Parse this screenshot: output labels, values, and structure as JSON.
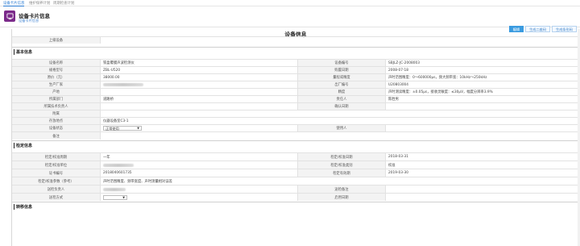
{
  "topnav": {
    "tabs": [
      "设备卡片信息",
      "维护保养计划",
      "周期检查计划"
    ]
  },
  "header": {
    "title": "设备卡片信息",
    "breadcrumb": "设备卡片信息"
  },
  "actions": {
    "edit": "编辑",
    "gen_qr": "生成二维码",
    "print_qr": "生成条形码"
  },
  "sheet": {
    "title": "设备信息"
  },
  "parent_device": {
    "label": "上级设备",
    "value": ""
  },
  "basic": {
    "section": "基本信息",
    "rows": [
      {
        "l1": "设备名称",
        "v1": "铁盒覆膜声波检测仪",
        "l2": "设备编号",
        "v2": "SBJLZ-JC-2008003"
      },
      {
        "l1": "规格型号",
        "v1": "ZBL-U520",
        "l2": "购置日期",
        "v2": "2008-07-18"
      },
      {
        "l1": "原价（元）",
        "v1": "38000.00",
        "l2": "量程或精度",
        "v2": "声时范围精度：0～600000μs，频大频带宽：10kHz～250kHz"
      },
      {
        "l1": "生产厂家",
        "v1": "",
        "l2": "出厂编号",
        "v2": "U20803004"
      },
      {
        "l1": "产地",
        "v1": "",
        "l2": "精度",
        "v2": "声时测读精度：±0.05μs，接收灵敏度：≤30μV，幅度分辨率3.9%"
      },
      {
        "l1": "所属部门",
        "v1": "道路桥",
        "l2": "责任人",
        "v2": "陈胜男"
      },
      {
        "l1": "所属技术负责人",
        "v1": "",
        "l2": "确认日期",
        "v2": ""
      },
      {
        "l1": "附属",
        "v1": "",
        "l2": "",
        "v2": ""
      },
      {
        "l1": "存放地点",
        "v1": "仪器设备室C3-1",
        "l2": "",
        "v2": ""
      },
      {
        "l1": "设备状态",
        "v1": "正常使用",
        "l2": "使用人",
        "v2": ""
      },
      {
        "l1": "备注",
        "v1": "",
        "l2": "",
        "v2": ""
      }
    ]
  },
  "verify": {
    "section": "检定信息",
    "rows": [
      {
        "l1": "检定/校准周期",
        "v1": "一年",
        "l2": "检定/校准日期",
        "v2": "2018-03-31"
      },
      {
        "l1": "检定/校准单位",
        "v1": "",
        "l2": "检定/校准类别",
        "v2": "校准"
      },
      {
        "l1": "证书编号",
        "v1": "2018040601735",
        "l2": "检定有效期",
        "v2": "2019-03-30"
      },
      {
        "l1": "检定/校准参数（参考）",
        "v1": "声时范围精度、频带宽度、声时测量相对误差",
        "l2": "",
        "v2": ""
      },
      {
        "l1": "送检负责人",
        "v1": "",
        "l2": "送检备注",
        "v2": ""
      },
      {
        "l1": "送检方式",
        "v1": "",
        "l2": "启用日期",
        "v2": ""
      }
    ]
  },
  "next_section": {
    "section": "转移信息"
  },
  "colors": {
    "accent": "#3a9be0",
    "app_icon": "#7b2a8a",
    "link": "#2a7bd3"
  }
}
